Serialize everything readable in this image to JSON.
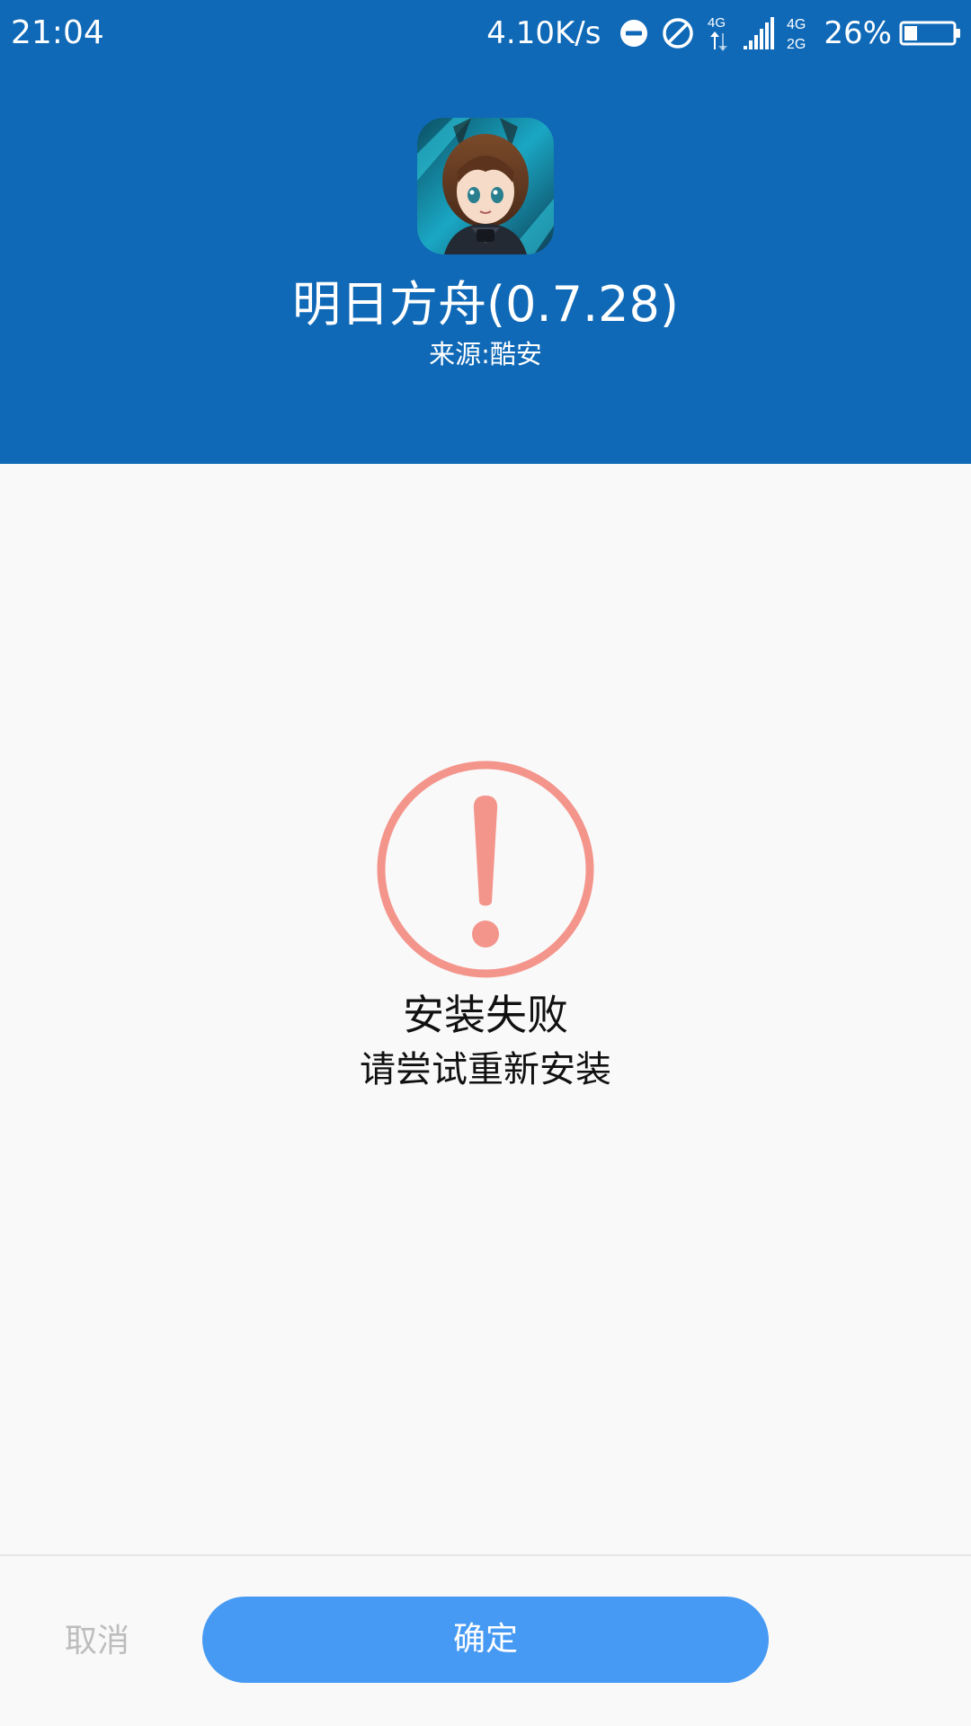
{
  "status_bar": {
    "time": "21:04",
    "net_speed": "4.10K/s",
    "battery_percent": "26%",
    "battery_level": 0.26,
    "icons": [
      "do-not-disturb-icon",
      "blocked-icon",
      "4g-data-icon",
      "signal-4g-icon",
      "signal-4g-2g-icon",
      "battery-icon"
    ],
    "signal_labels": {
      "sim1_tech": "4G",
      "sim2_tech_top": "4G",
      "sim2_tech_bottom": "2G"
    }
  },
  "app": {
    "title": "明日方舟(0.7.28)",
    "source": "来源:酷安",
    "icon": "app-avatar-icon"
  },
  "result": {
    "icon": "alert-circle-icon",
    "title": "安装失败",
    "subtitle": "请尝试重新安装",
    "accent_color": "#f4958c"
  },
  "actions": {
    "cancel_label": "取消",
    "confirm_label": "确定"
  },
  "colors": {
    "header_bg": "#0f69b7",
    "confirm_bg": "#479af3",
    "cancel_text": "#bdbdbd",
    "page_bg": "#f9f9f9"
  }
}
